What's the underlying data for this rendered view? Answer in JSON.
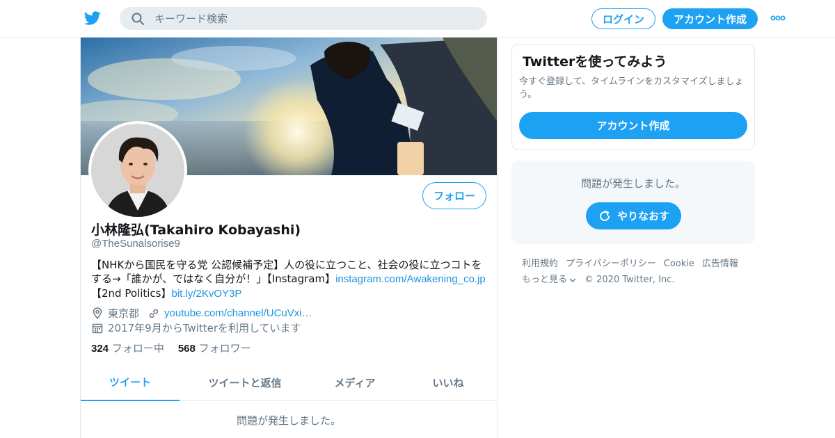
{
  "header": {
    "search_placeholder": "キーワード検索",
    "login_label": "ログイン",
    "signup_label": "アカウント作成"
  },
  "profile": {
    "follow_label": "フォロー",
    "name": "小林隆弘(Takahiro Kobayashi)",
    "handle": "@TheSunalsorise9",
    "bio_text_1": "【NHKから国民を守る党 公認候補予定】人の役に立つこと、社会の役に立つコトをする→「誰かが、ではなく自分が！」【Instagram】",
    "bio_link_1": "instagram.com/Awakening_co.jp",
    "bio_text_2": "【2nd Politics】",
    "bio_link_2": "bit.ly/2KvOY3P",
    "location": "東京都",
    "website": "youtube.com/channel/UCuVxi…",
    "joined": "2017年9月からTwitterを利用しています",
    "following_count": "324",
    "following_label": "フォロー中",
    "followers_count": "568",
    "followers_label": "フォロワー",
    "tabs": [
      {
        "label": "ツイート",
        "active": true
      },
      {
        "label": "ツイートと返信",
        "active": false
      },
      {
        "label": "メディア",
        "active": false
      },
      {
        "label": "いいね",
        "active": false
      }
    ],
    "timeline_error": "問題が発生しました。"
  },
  "sidebar": {
    "signup_title": "Twitterを使ってみよう",
    "signup_desc": "今すぐ登録して、タイムラインをカスタマイズしましょう。",
    "signup_button": "アカウント作成",
    "error_message": "問題が発生しました。",
    "retry_label": "やりなおす"
  },
  "footer": {
    "links": [
      "利用規約",
      "プライバシーポリシー",
      "Cookie",
      "広告情報"
    ],
    "more_label": "もっと見る",
    "copyright": "© 2020 Twitter, Inc."
  },
  "colors": {
    "brand": "#1da1f2",
    "link": "#1b95e0",
    "muted": "#657786",
    "border": "#e1e8ed"
  },
  "icons": [
    "twitter-bird-icon",
    "search-icon",
    "more-dots-icon",
    "location-pin-icon",
    "link-icon",
    "calendar-icon",
    "refresh-icon",
    "chevron-down-icon"
  ]
}
